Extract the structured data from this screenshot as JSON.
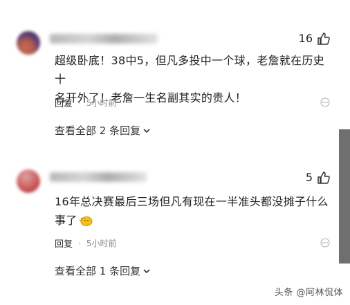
{
  "comments": [
    {
      "likes": "16",
      "text_line1": "超级卧底！38中5，但凡多投中一个球，老詹就在历史十",
      "text_line2": "名开外了！老詹一生名副其实的贵人！",
      "reply_label": "回复",
      "dot": "·",
      "time": "5小时前",
      "view_replies": "查看全部 2 条回复"
    },
    {
      "likes": "5",
      "text_line1": "16年总决赛最后三场但凡有现在一半准头都没摊子什么",
      "text_line2": "事了",
      "reply_label": "回复",
      "dot": "·",
      "time": "5小时前",
      "view_replies": "查看全部 1 条回复"
    }
  ],
  "watermark": "头条 @阿林侃体",
  "icons": {
    "like": "thumbs-up-icon",
    "more": "more-dots-icon",
    "chevron": "chevron-down-icon",
    "emoji": "emoji-icon"
  },
  "colors": {
    "text": "#222222",
    "meta": "#8a8a8a",
    "scrollbar": "#6f6f6f"
  }
}
